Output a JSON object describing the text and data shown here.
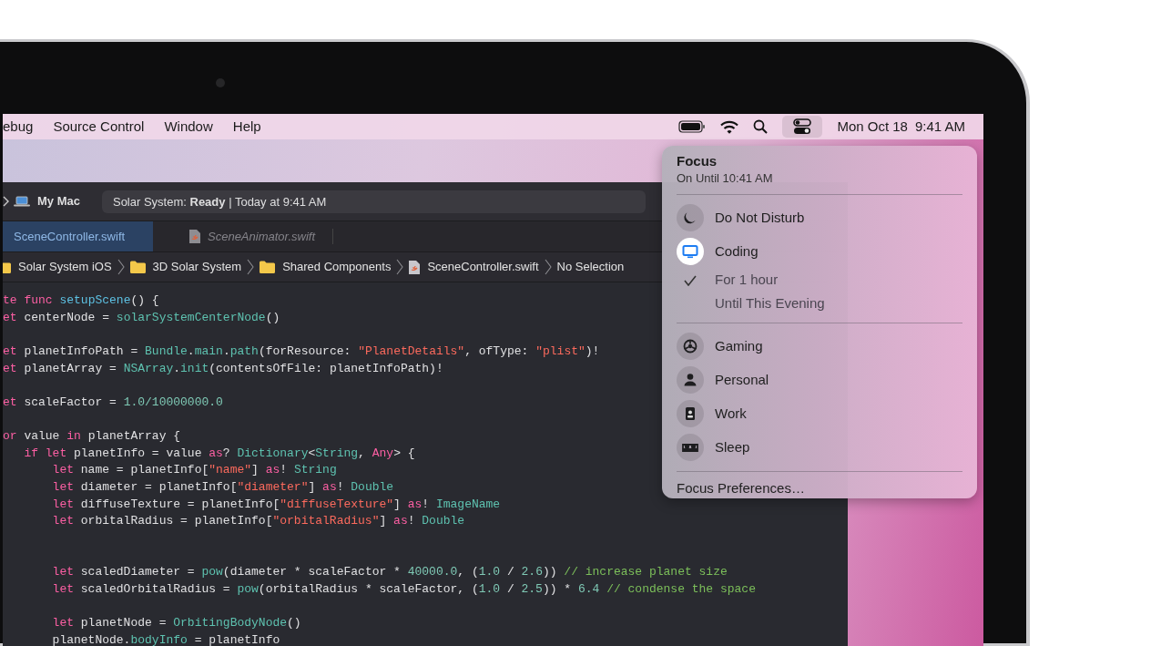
{
  "menu_bar": {
    "menus": [
      "ebug",
      "Source Control",
      "Window",
      "Help"
    ],
    "control_center_active": true,
    "date": "Mon Oct 18",
    "time": "9:41 AM"
  },
  "toolbar": {
    "destination": "My Mac",
    "status": "Solar System: **Ready** | Today at 9:41 AM"
  },
  "tabs": [
    {
      "label": "SceneController.swift",
      "selected": true
    },
    {
      "label": "SceneAnimator.swift",
      "selected": false
    }
  ],
  "breadcrumbs": [
    {
      "label": "Solar System iOS",
      "kind": "folder"
    },
    {
      "label": "3D Solar System",
      "kind": "folder"
    },
    {
      "label": "Shared Components",
      "kind": "folder"
    },
    {
      "label": "SceneController.swift",
      "kind": "file"
    },
    {
      "label": "No Selection",
      "kind": "plain"
    }
  ],
  "code_lines": [
    {
      "kind": "code",
      "tokens": [
        {
          "kind": "keyword",
          "text": "te func "
        },
        {
          "kind": "declaration",
          "text": "setupScene"
        },
        {
          "kind": "plain",
          "text": "() {"
        }
      ]
    },
    {
      "kind": "code",
      "tokens": [
        {
          "kind": "keyword",
          "text": "et "
        },
        {
          "kind": "plain",
          "text": "centerNode = "
        },
        {
          "kind": "type",
          "text": "solarSystemCenterNode"
        },
        {
          "kind": "plain",
          "text": "()"
        }
      ]
    },
    {
      "kind": "blank"
    },
    {
      "kind": "code",
      "tokens": [
        {
          "kind": "keyword",
          "text": "et "
        },
        {
          "kind": "plain",
          "text": "planetInfoPath = "
        },
        {
          "kind": "type",
          "text": "Bundle"
        },
        {
          "kind": "plain",
          "text": "."
        },
        {
          "kind": "type",
          "text": "main"
        },
        {
          "kind": "plain",
          "text": "."
        },
        {
          "kind": "type",
          "text": "path"
        },
        {
          "kind": "plain",
          "text": "(forResource: "
        },
        {
          "kind": "string",
          "text": "\"PlanetDetails\""
        },
        {
          "kind": "plain",
          "text": ", ofType: "
        },
        {
          "kind": "string",
          "text": "\"plist\""
        },
        {
          "kind": "plain",
          "text": ")!"
        }
      ]
    },
    {
      "kind": "code",
      "tokens": [
        {
          "kind": "keyword",
          "text": "et "
        },
        {
          "kind": "plain",
          "text": "planetArray = "
        },
        {
          "kind": "type",
          "text": "NSArray"
        },
        {
          "kind": "plain",
          "text": "."
        },
        {
          "kind": "type",
          "text": "init"
        },
        {
          "kind": "plain",
          "text": "(contentsOfFile: planetInfoPath)!"
        }
      ]
    },
    {
      "kind": "blank"
    },
    {
      "kind": "code",
      "tokens": [
        {
          "kind": "keyword",
          "text": "et "
        },
        {
          "kind": "plain",
          "text": "scaleFactor = "
        },
        {
          "kind": "number",
          "text": "1.0/10000000.0"
        }
      ]
    },
    {
      "kind": "blank"
    },
    {
      "kind": "code",
      "tokens": [
        {
          "kind": "keyword",
          "text": "or "
        },
        {
          "kind": "plain",
          "text": "value "
        },
        {
          "kind": "keyword",
          "text": "in"
        },
        {
          "kind": "plain",
          "text": " planetArray {"
        }
      ]
    },
    {
      "kind": "code",
      "tokens": [
        {
          "kind": "keyword",
          "text": "   if let"
        },
        {
          "kind": "plain",
          "text": " planetInfo = value "
        },
        {
          "kind": "keyword",
          "text": "as"
        },
        {
          "kind": "plain",
          "text": "? "
        },
        {
          "kind": "type",
          "text": "Dictionary"
        },
        {
          "kind": "plain",
          "text": "<"
        },
        {
          "kind": "type",
          "text": "String"
        },
        {
          "kind": "plain",
          "text": ", "
        },
        {
          "kind": "keyword",
          "text": "Any"
        },
        {
          "kind": "plain",
          "text": "> {"
        }
      ]
    },
    {
      "kind": "code",
      "tokens": [
        {
          "kind": "keyword",
          "text": "       let"
        },
        {
          "kind": "plain",
          "text": " name = planetInfo["
        },
        {
          "kind": "string",
          "text": "\"name\""
        },
        {
          "kind": "plain",
          "text": "] "
        },
        {
          "kind": "keyword",
          "text": "as"
        },
        {
          "kind": "plain",
          "text": "! "
        },
        {
          "kind": "type",
          "text": "String"
        }
      ]
    },
    {
      "kind": "code",
      "tokens": [
        {
          "kind": "keyword",
          "text": "       let"
        },
        {
          "kind": "plain",
          "text": " diameter = planetInfo["
        },
        {
          "kind": "string",
          "text": "\"diameter\""
        },
        {
          "kind": "plain",
          "text": "] "
        },
        {
          "kind": "keyword",
          "text": "as"
        },
        {
          "kind": "plain",
          "text": "! "
        },
        {
          "kind": "type",
          "text": "Double"
        }
      ]
    },
    {
      "kind": "code",
      "tokens": [
        {
          "kind": "keyword",
          "text": "       let"
        },
        {
          "kind": "plain",
          "text": " diffuseTexture = planetInfo["
        },
        {
          "kind": "string",
          "text": "\"diffuseTexture\""
        },
        {
          "kind": "plain",
          "text": "] "
        },
        {
          "kind": "keyword",
          "text": "as"
        },
        {
          "kind": "plain",
          "text": "! "
        },
        {
          "kind": "type",
          "text": "ImageName"
        }
      ]
    },
    {
      "kind": "code",
      "tokens": [
        {
          "kind": "keyword",
          "text": "       let"
        },
        {
          "kind": "plain",
          "text": " orbitalRadius = planetInfo["
        },
        {
          "kind": "string",
          "text": "\"orbitalRadius\""
        },
        {
          "kind": "plain",
          "text": "] "
        },
        {
          "kind": "keyword",
          "text": "as"
        },
        {
          "kind": "plain",
          "text": "! "
        },
        {
          "kind": "type",
          "text": "Double"
        }
      ]
    },
    {
      "kind": "blank"
    },
    {
      "kind": "blank"
    },
    {
      "kind": "code",
      "tokens": [
        {
          "kind": "keyword",
          "text": "       let"
        },
        {
          "kind": "plain",
          "text": " scaledDiameter = "
        },
        {
          "kind": "type",
          "text": "pow"
        },
        {
          "kind": "plain",
          "text": "(diameter * scaleFactor * "
        },
        {
          "kind": "number",
          "text": "40000.0"
        },
        {
          "kind": "plain",
          "text": ", ("
        },
        {
          "kind": "number",
          "text": "1.0"
        },
        {
          "kind": "plain",
          "text": " / "
        },
        {
          "kind": "number",
          "text": "2.6"
        },
        {
          "kind": "plain",
          "text": "))"
        },
        {
          "kind": "comment",
          "text": " // increase planet size"
        }
      ]
    },
    {
      "kind": "code",
      "tokens": [
        {
          "kind": "keyword",
          "text": "       let"
        },
        {
          "kind": "plain",
          "text": " scaledOrbitalRadius = "
        },
        {
          "kind": "type",
          "text": "pow"
        },
        {
          "kind": "plain",
          "text": "(orbitalRadius * scaleFactor, ("
        },
        {
          "kind": "number",
          "text": "1.0"
        },
        {
          "kind": "plain",
          "text": " / "
        },
        {
          "kind": "number",
          "text": "2.5"
        },
        {
          "kind": "plain",
          "text": ")) * "
        },
        {
          "kind": "number",
          "text": "6.4"
        },
        {
          "kind": "comment",
          "text": " // condense the space"
        }
      ]
    },
    {
      "kind": "blank"
    },
    {
      "kind": "code",
      "tokens": [
        {
          "kind": "keyword",
          "text": "       let"
        },
        {
          "kind": "plain",
          "text": " planetNode = "
        },
        {
          "kind": "type",
          "text": "OrbitingBodyNode"
        },
        {
          "kind": "plain",
          "text": "()"
        }
      ]
    },
    {
      "kind": "code",
      "tokens": [
        {
          "kind": "plain",
          "text": "       planetNode."
        },
        {
          "kind": "type",
          "text": "bodyInfo"
        },
        {
          "kind": "plain",
          "text": " = planetInfo"
        }
      ]
    }
  ],
  "focus_menu": {
    "title": "Focus",
    "subtitle": "On Until 10:41 AM",
    "groups": [
      {
        "modes": [
          {
            "label": "Do Not Disturb",
            "selected": false
          },
          {
            "label": "Coding",
            "selected": true,
            "options": [
              {
                "label": "For 1 hour",
                "checked": true
              },
              {
                "label": "Until This Evening",
                "checked": false
              }
            ]
          }
        ]
      },
      {
        "modes": [
          {
            "label": "Gaming",
            "selected": false
          },
          {
            "label": "Personal",
            "selected": false
          },
          {
            "label": "Work",
            "selected": false
          },
          {
            "label": "Sleep",
            "selected": false
          }
        ]
      }
    ],
    "footer": "Focus Preferences…"
  }
}
